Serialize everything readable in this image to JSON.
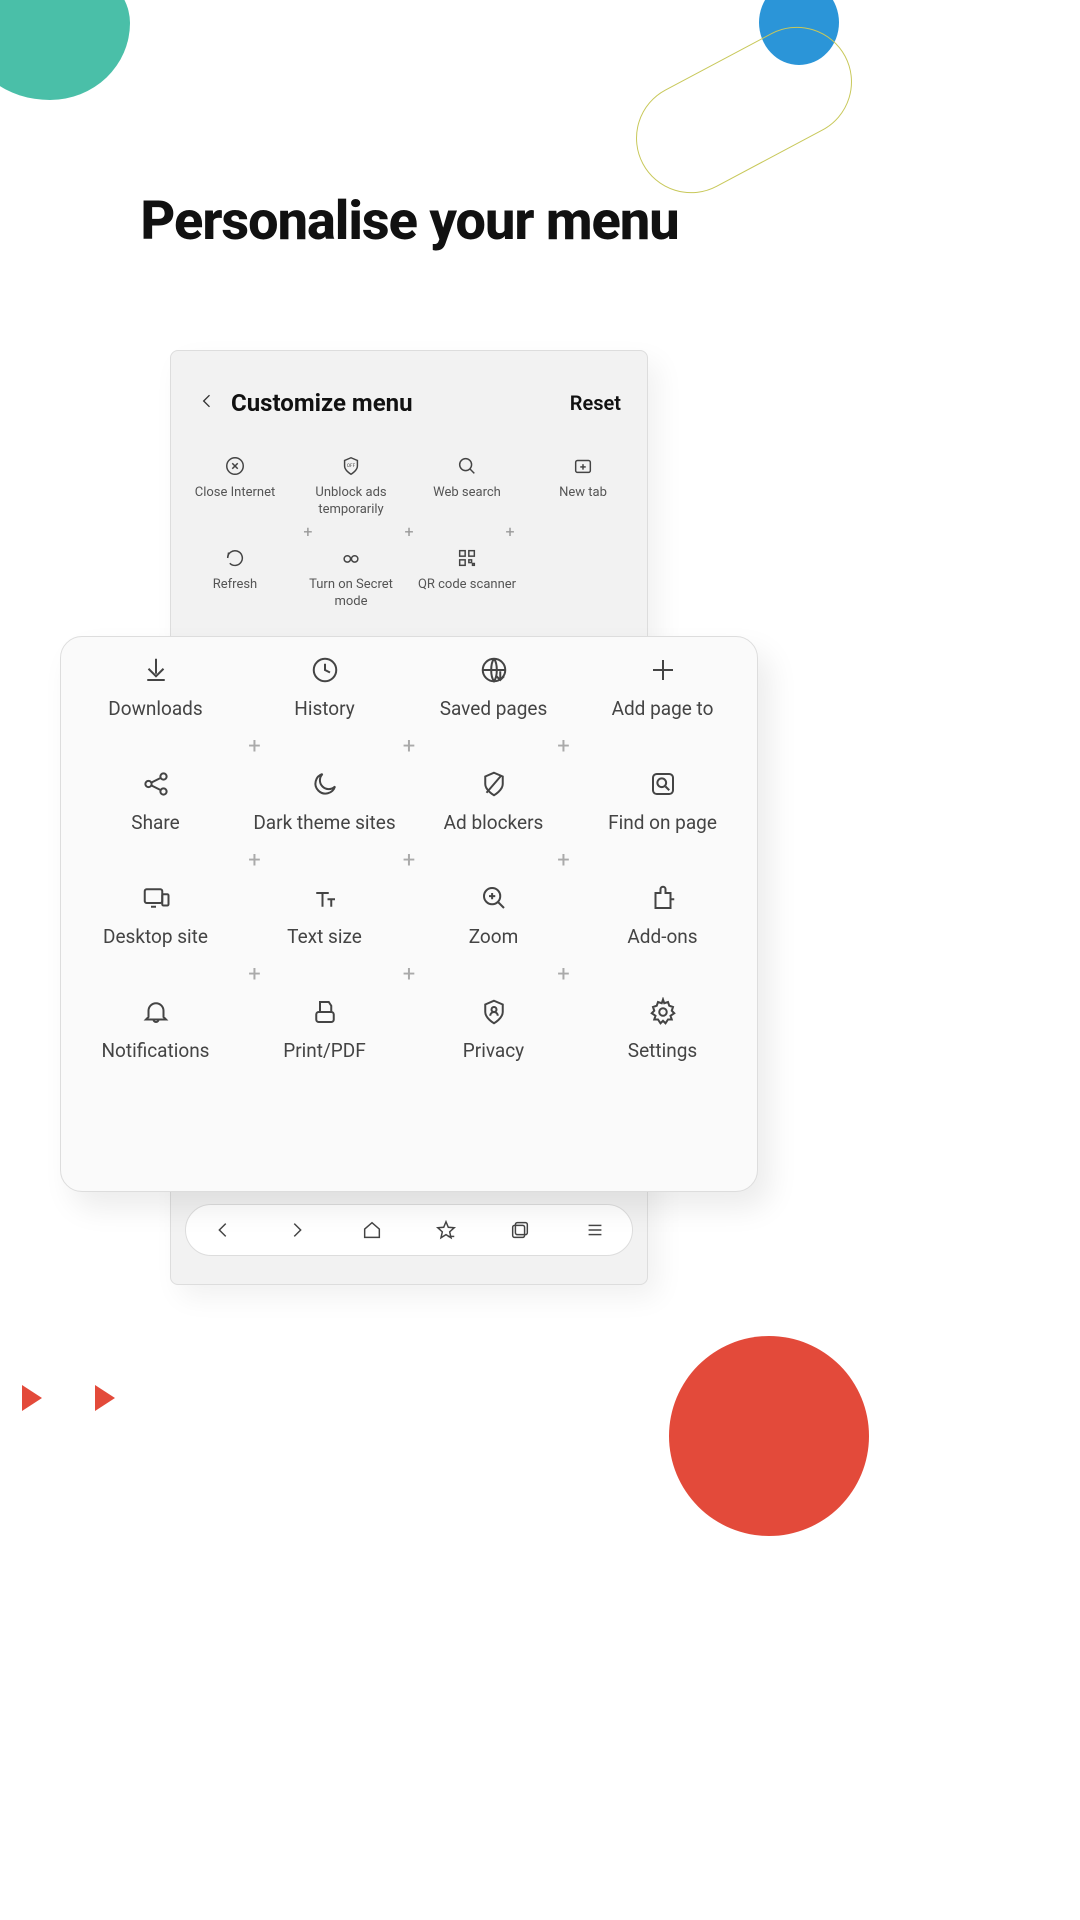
{
  "headline": "Personalise your menu",
  "phone": {
    "title": "Customize menu",
    "reset": "Reset",
    "row1": [
      {
        "icon": "close-circle-icon",
        "label": "Close Internet"
      },
      {
        "icon": "shield-off-icon",
        "label": "Unblock ads temporarily"
      },
      {
        "icon": "search-icon",
        "label": "Web search"
      },
      {
        "icon": "new-tab-icon",
        "label": "New tab"
      }
    ],
    "row2": [
      {
        "icon": "refresh-icon",
        "label": "Refresh"
      },
      {
        "icon": "mask-icon",
        "label": "Turn on Secret mode"
      },
      {
        "icon": "qr-icon",
        "label": "QR code scanner"
      }
    ]
  },
  "overlay": {
    "rows": [
      [
        {
          "icon": "download-icon",
          "label": "Downloads"
        },
        {
          "icon": "history-icon",
          "label": "History"
        },
        {
          "icon": "saved-pages-icon",
          "label": "Saved pages"
        },
        {
          "icon": "plus-icon",
          "label": "Add page to"
        }
      ],
      [
        {
          "icon": "share-icon",
          "label": "Share"
        },
        {
          "icon": "moon-icon",
          "label": "Dark theme sites"
        },
        {
          "icon": "shield-icon",
          "label": "Ad blockers"
        },
        {
          "icon": "find-icon",
          "label": "Find on page"
        }
      ],
      [
        {
          "icon": "desktop-icon",
          "label": "Desktop site"
        },
        {
          "icon": "text-size-icon",
          "label": "Text size"
        },
        {
          "icon": "zoom-icon",
          "label": "Zoom"
        },
        {
          "icon": "puzzle-icon",
          "label": "Add-ons"
        }
      ],
      [
        {
          "icon": "bell-icon",
          "label": "Notifications"
        },
        {
          "icon": "print-icon",
          "label": "Print/PDF"
        },
        {
          "icon": "privacy-icon",
          "label": "Privacy"
        },
        {
          "icon": "gear-icon",
          "label": "Settings"
        }
      ]
    ]
  },
  "navbar": [
    "chevron-left-icon",
    "chevron-right-icon",
    "home-icon",
    "star-icon",
    "tabs-icon",
    "menu-icon"
  ]
}
